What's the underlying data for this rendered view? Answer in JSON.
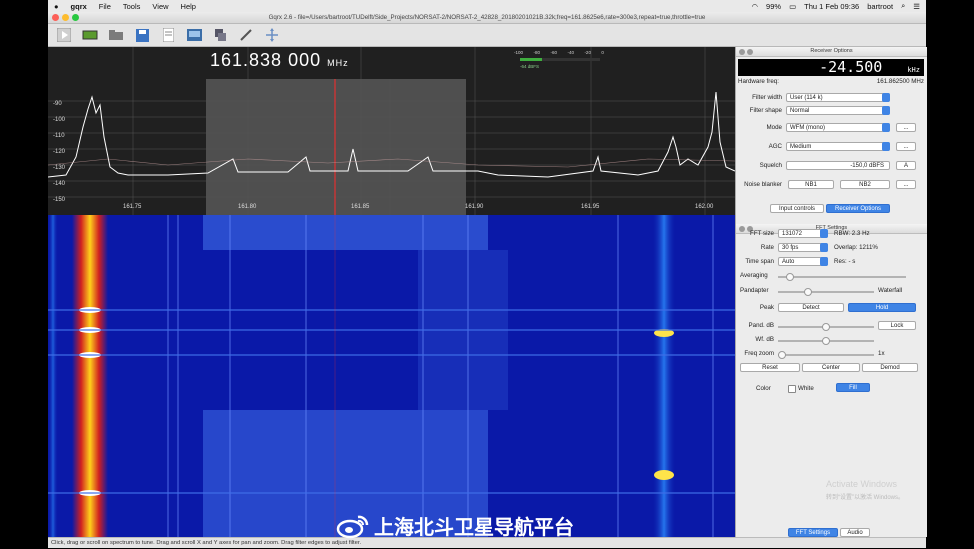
{
  "menubar": {
    "app": "gqrx",
    "items": [
      "File",
      "Tools",
      "View",
      "Help"
    ],
    "date_time": "Thu 1 Feb  09:36",
    "user": "bartroot",
    "battery": "99%"
  },
  "window": {
    "title": "Gqrx 2.6 - file=/Users/bartroot/TUDelft/Side_Projects/NORSAT-2/NORSAT-2_42828_20180201021B.32k;freq=161.8625e6,rate=300e3,repeat=true,throttle=true"
  },
  "spectrum": {
    "frequency_display": "161.838 000",
    "frequency_unit": "MHz",
    "y_ticks": [
      "-90",
      "-100",
      "-110",
      "-120",
      "-130",
      "-140",
      "-150"
    ],
    "x_ticks": [
      "161.75",
      "161.80",
      "161.85",
      "161.90",
      "161.95",
      "162.00"
    ],
    "smeter_ticks": [
      "-100",
      "-80",
      "-60",
      "-40",
      "-20",
      "0"
    ],
    "smeter_value": "-64 dBFS"
  },
  "receiver_options": {
    "header": "Receiver Options",
    "offset_value": "-24.500",
    "offset_unit": "kHz",
    "hw_freq_label": "Hardware freq:",
    "hw_freq_value": "161.862500 MHz",
    "filter_width_label": "Filter width",
    "filter_width_value": "User (114 k)",
    "filter_shape_label": "Filter shape",
    "filter_shape_value": "Normal",
    "mode_label": "Mode",
    "mode_value": "WFM (mono)",
    "agc_label": "AGC",
    "agc_value": "Medium",
    "squelch_label": "Squelch",
    "squelch_value": "-150,0 dBFS",
    "squelch_btn": "A",
    "noise_blanker_label": "Noise blanker",
    "nb1": "NB1",
    "nb2": "NB2",
    "more": "...",
    "tab_input": "Input controls",
    "tab_receiver": "Receiver Options"
  },
  "fft_settings": {
    "header": "FFT Settings",
    "fft_size_label": "FFT size",
    "fft_size_value": "131072",
    "rbw": "RBW: 2.3 Hz",
    "rate_label": "Rate",
    "rate_value": "30 fps",
    "overlap": "Overlap: 1211%",
    "time_span_label": "Time span",
    "time_span_value": "Auto",
    "res": "Res: - s",
    "averaging_label": "Averaging",
    "pandapter_label": "Pandapter",
    "waterfall_label": "Waterfall",
    "peak_label": "Peak",
    "detect_btn": "Detect",
    "hold_btn": "Hold",
    "pand_db_label": "Pand. dB",
    "lock_btn": "Lock",
    "wf_db_label": "Wf. dB",
    "freq_zoom_label": "Freq zoom",
    "freq_zoom_value": "1x",
    "reset_btn": "Reset",
    "center_btn": "Center",
    "demod_btn": "Demod",
    "color_label": "Color",
    "white_label": "White",
    "fill_btn": "Fill",
    "tab_fft": "FFT Settings",
    "tab_audio": "Audio"
  },
  "statusbar": {
    "text": "Click, drag or scroll on spectrum to tune. Drag and scroll X and Y axes for pan and zoom. Drag filter edges to adjust filter."
  },
  "overlays": {
    "activate_windows": "Activate Windows",
    "activate_windows_sub": "转到“设置”以激活 Windows。",
    "weibo_text": "上海北斗卫星导航平台"
  },
  "colors": {
    "accent": "#3f84e5",
    "waterfall_bg": "#0a19a8",
    "spectrum_bg": "#202020",
    "filter_line": "#ff2a2a"
  }
}
